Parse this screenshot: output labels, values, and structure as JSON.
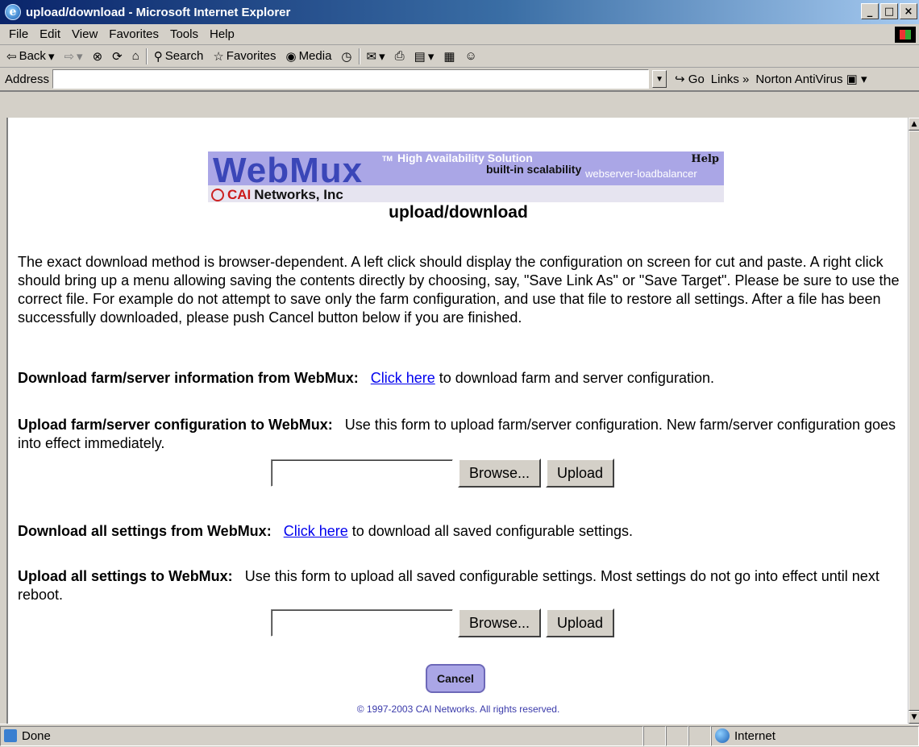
{
  "window": {
    "title": "upload/download - Microsoft Internet Explorer",
    "minimize": "_",
    "maximize": "□",
    "close": "×"
  },
  "menu": [
    "File",
    "Edit",
    "View",
    "Favorites",
    "Tools",
    "Help"
  ],
  "toolbar": {
    "back": "Back",
    "search": "Search",
    "favorites": "Favorites",
    "media": "Media"
  },
  "address": {
    "label": "Address",
    "value": "",
    "go": "Go",
    "links": "Links",
    "norton": "Norton AntiVirus"
  },
  "banner": {
    "logo": "WebMux",
    "tm": "TM",
    "tagline": "High Availability Solution",
    "scalability": "built-in scalability",
    "loadbalancer": "webserver-loadbalancer",
    "help": "Help",
    "company_strong": "CAI",
    "company_rest": "Networks, Inc"
  },
  "page": {
    "heading": "upload/download",
    "intro": "The exact download method is browser-dependent. A left click should display the configuration on screen for cut and paste. A right click should bring up a menu allowing saving the contents directly by choosing, say, \"Save Link As\" or \"Save Target\". Please be sure to use the correct file. For example do not attempt to save only the farm configuration, and use that file to restore all settings. After a file has been successfully downloaded, please push Cancel button below if you are finished.",
    "download_farm": {
      "label": "Download farm/server information from WebMux:",
      "link": "Click here",
      "rest": "to download farm and server configuration."
    },
    "upload_farm": {
      "label": "Upload farm/server configuration to WebMux:",
      "text": "Use this form to upload farm/server configuration. New farm/server configuration goes into effect immediately.",
      "browse": "Browse...",
      "upload": "Upload"
    },
    "download_all": {
      "label": "Download all settings from WebMux:",
      "link": "Click here",
      "rest": "to download all saved configurable settings."
    },
    "upload_all": {
      "label": "Upload all settings to WebMux:",
      "text": "Use this form to upload all saved configurable settings. Most settings do not go into effect until next reboot.",
      "browse": "Browse...",
      "upload": "Upload"
    },
    "cancel": "Cancel",
    "copyright": "© 1997-2003 CAI Networks. All rights reserved."
  },
  "status": {
    "text": "Done",
    "zone": "Internet"
  }
}
